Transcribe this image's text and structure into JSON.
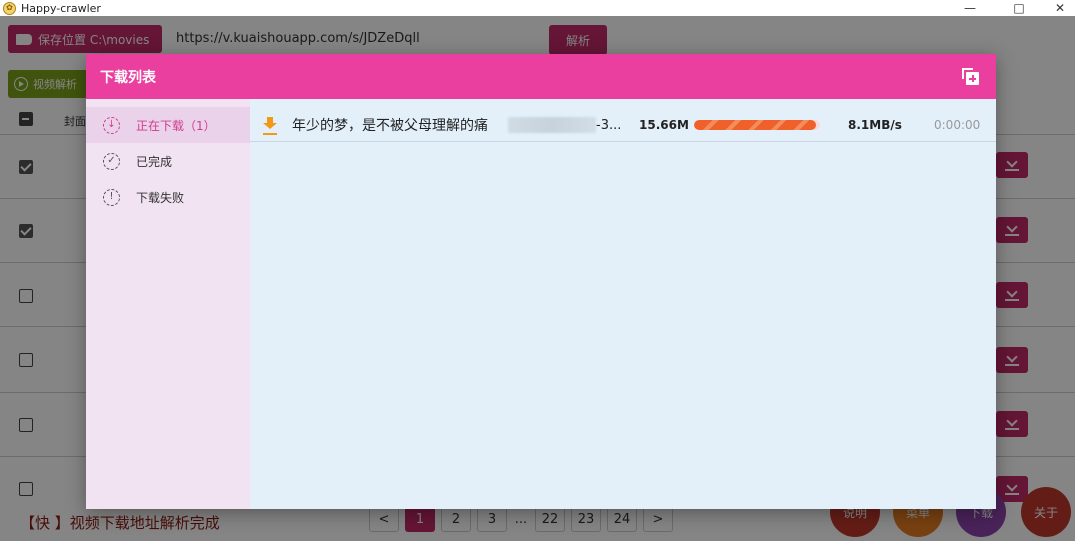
{
  "window": {
    "title": "Happy-crawler",
    "minimize": "—",
    "maximize": "□",
    "close": "✕"
  },
  "toolbar": {
    "save_location_label": "保存位置 C:\\movies",
    "url_value": "https://v.kuaishouapp.com/s/JDZeDqll",
    "parse_button": "解析",
    "parse_video_button": "视频解析"
  },
  "table": {
    "cover_header": "封面",
    "rows": [
      {
        "checked": true
      },
      {
        "checked": true
      },
      {
        "checked": false
      },
      {
        "checked": false
      },
      {
        "checked": false
      },
      {
        "checked": false
      }
    ]
  },
  "status": {
    "message": "【快    】视频下载地址解析完成"
  },
  "pagination": {
    "prev": "<",
    "pages": [
      "1",
      "2",
      "3",
      "...",
      "22",
      "23",
      "24"
    ],
    "current": "1",
    "next": ">"
  },
  "fabs": [
    {
      "label": "说明",
      "color": "#c0392b"
    },
    {
      "label": "菜单",
      "color": "#e67e22"
    },
    {
      "label": "下载",
      "color": "#8e44ad"
    },
    {
      "label": "关于",
      "color": "#c0392b"
    }
  ],
  "dialog": {
    "title": "下载列表",
    "header_icon": "add-to-queue-icon",
    "sidebar": [
      {
        "label": "正在下载（1）",
        "icon": "downloading-icon",
        "active": true
      },
      {
        "label": "已完成",
        "icon": "completed-icon",
        "active": false
      },
      {
        "label": "下载失败",
        "icon": "failed-icon",
        "active": false
      }
    ],
    "task": {
      "name": "年少的梦，是不被父母理解的痛",
      "name_tail": "-3...",
      "size": "15.66M",
      "progress": 0.97,
      "speed": "8.1MB/s",
      "time": "0:00:00"
    }
  },
  "colors": {
    "accent": "#c22a69",
    "dialog_header": "#ea3f9f",
    "progress": "#f0602a"
  }
}
